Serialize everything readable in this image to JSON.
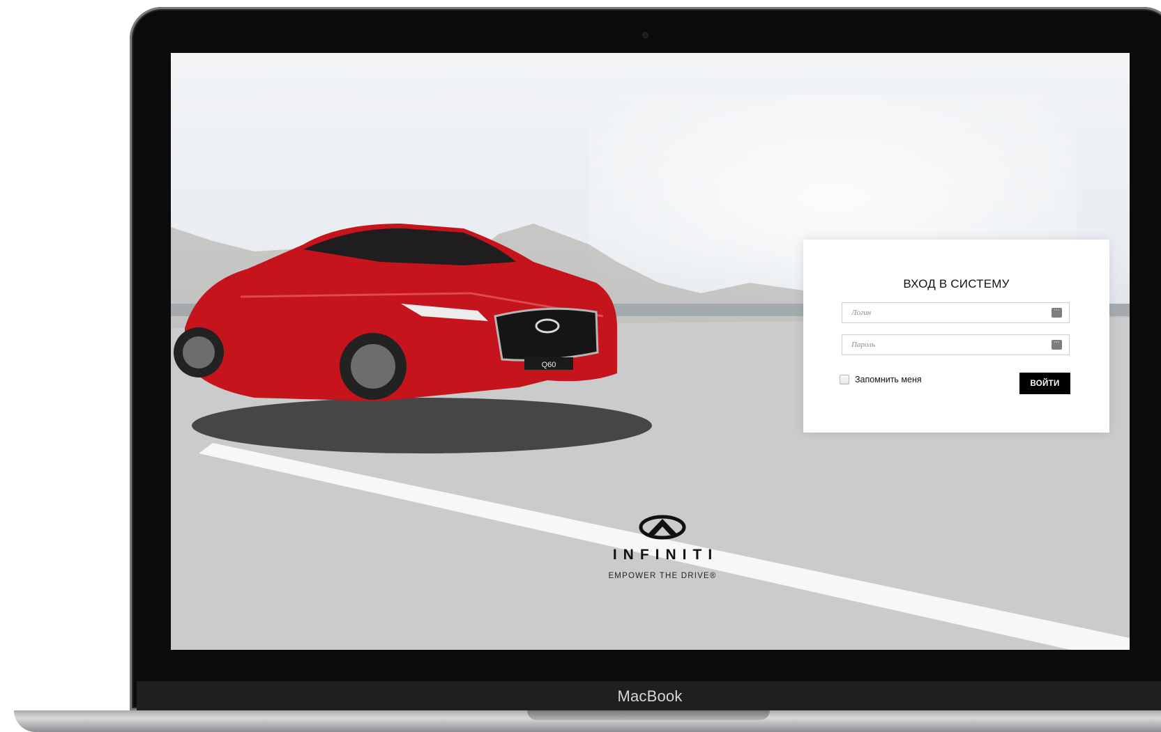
{
  "device": {
    "brand_text": "MacBook"
  },
  "login": {
    "title": "ВХОД В СИСТЕМУ",
    "username_placeholder": "Логин",
    "password_placeholder": "Пароль",
    "remember_label": "Запомнить меня",
    "submit_label": "ВОЙТИ"
  },
  "car": {
    "plate_text": "Q60"
  },
  "brand": {
    "wordmark": "INFINITI",
    "tagline": "EMPOWER THE DRIVE®"
  },
  "colors": {
    "car_red": "#c5141b",
    "button_bg": "#000000",
    "panel_bg": "#ffffff"
  },
  "icons": {
    "username_field": "keyboard-icon",
    "password_field": "keyboard-icon",
    "logo": "infiniti-logo-icon"
  }
}
